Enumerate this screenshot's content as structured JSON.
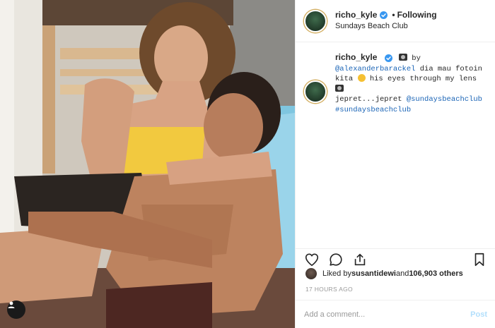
{
  "post": {
    "image_alt": "Couple posing on a blue beach lounger",
    "tag_icon": "user-tag-icon"
  },
  "header": {
    "username": "richo_kyle",
    "separator": "•",
    "follow_status": "Following",
    "location": "Sundays Beach Club",
    "verified_icon": "verified-badge-icon"
  },
  "caption": {
    "username": "richo_kyle",
    "by": " by",
    "mention_1": "@alexanderbarackel",
    "text_1": " dia mau fotoin kita ",
    "text_2": " his eyes through my lens ",
    "text_3": "jepret...jepret ",
    "mention_2": "@sundaysbeachclub",
    "hashtag": "#sundaysbeachclub"
  },
  "actions": {
    "like_icon": "heart-icon",
    "comment_icon": "comment-icon",
    "share_icon": "share-icon",
    "save_icon": "bookmark-icon"
  },
  "likes": {
    "prefix": "Liked by ",
    "user": "susantidewi",
    "middle": " and ",
    "count": "106,903 others"
  },
  "timestamp": "17 HOURS AGO",
  "comment": {
    "placeholder": "Add a comment...",
    "post_label": "Post"
  },
  "colors": {
    "link": "#1a64b6",
    "post_disabled": "#b2dffc",
    "verified": "#3897f0"
  }
}
